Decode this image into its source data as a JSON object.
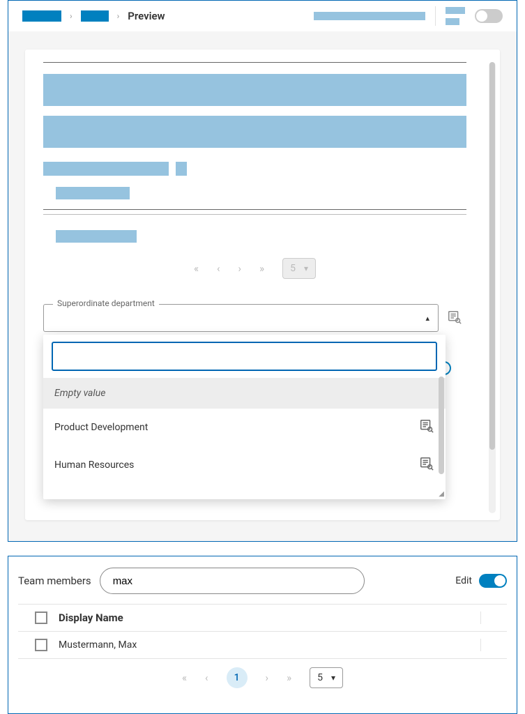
{
  "breadcrumb": {
    "previewLabel": "Preview"
  },
  "pager_upper": {
    "size": "5"
  },
  "superordinate": {
    "label": "Superordinate department",
    "options": {
      "empty": "Empty value",
      "o1": "Product Development",
      "o2": "Human Resources"
    }
  },
  "team": {
    "title": "Team members",
    "search": "max",
    "editLabel": "Edit",
    "columns": {
      "displayName": "Display Name"
    },
    "rows": {
      "r1": {
        "displayName": "Mustermann, Max"
      }
    },
    "pager": {
      "page": "1",
      "size": "5"
    }
  }
}
